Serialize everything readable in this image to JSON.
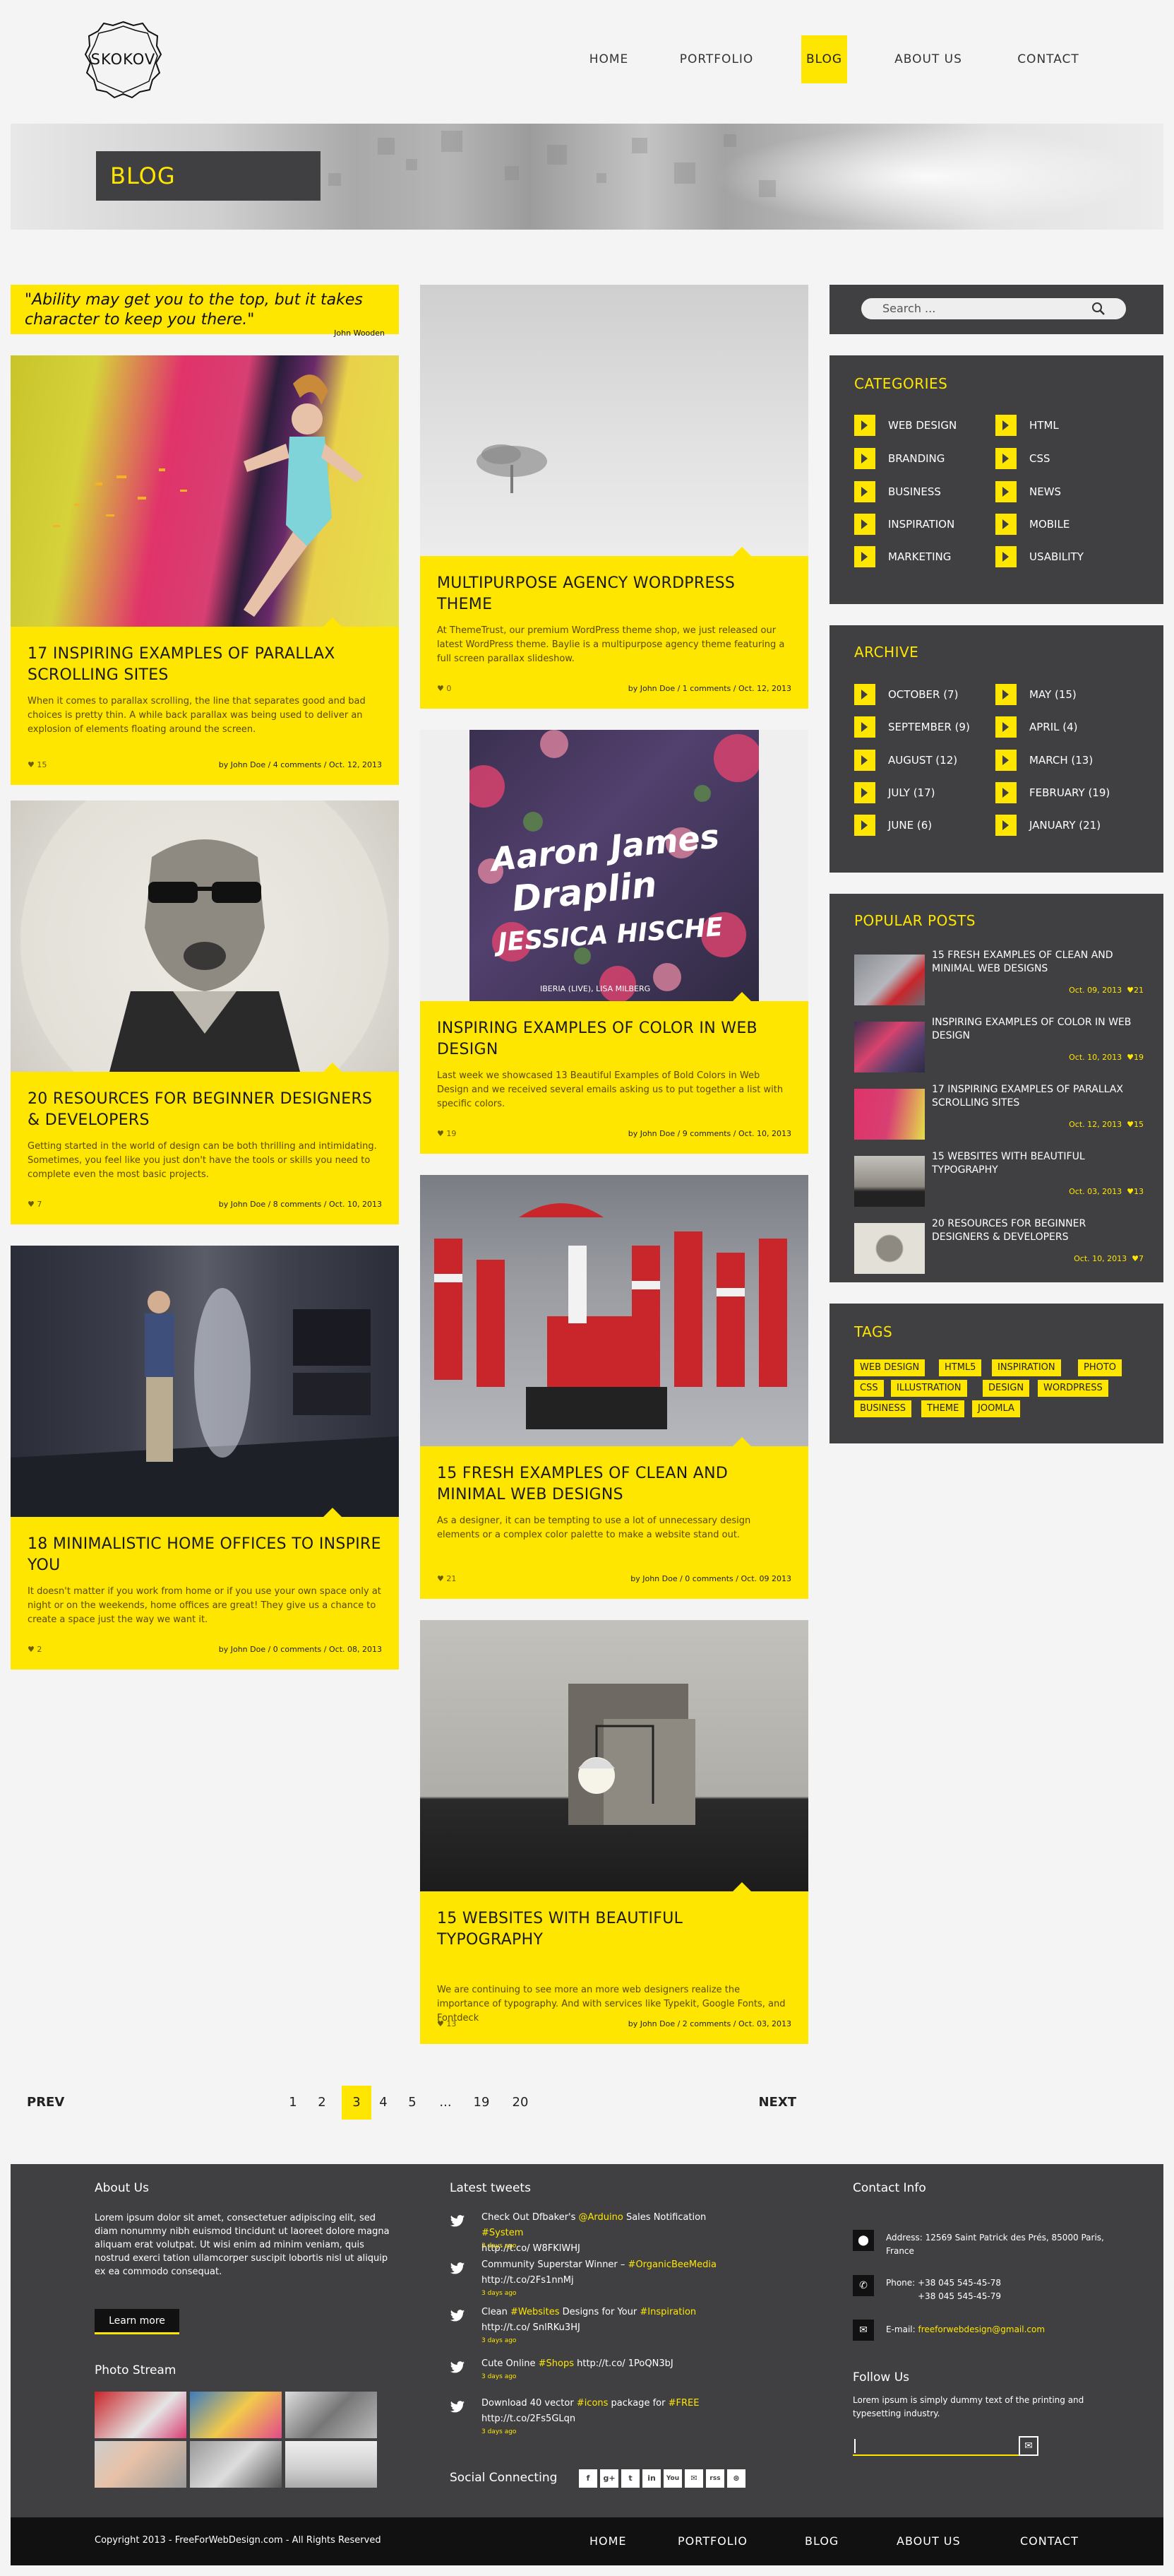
{
  "header": {
    "logo": "SKOKOV",
    "nav": [
      "HOME",
      "PORTFOLIO",
      "BLOG",
      "ABOUT US",
      "CONTACT"
    ],
    "active": "BLOG"
  },
  "banner": {
    "title": "BLOG"
  },
  "quote": {
    "text": "\"Ability may get you to the top, but it takes character to keep you there.\"",
    "author": "John Wooden"
  },
  "posts_left": [
    {
      "title": "17 INSPIRING EXAMPLES OF PARALLAX SCROLLING SITES",
      "excerpt": "When it comes to parallax scrolling, the line that separates good and bad choices is pretty thin. A while back parallax was being used to deliver an explosion of elements floating around the screen.",
      "likes": "15",
      "meta": "by John Doe  /  4 comments  /  Oct. 12, 2013"
    },
    {
      "title": "20 RESOURCES FOR BEGINNER DESIGNERS & DEVELOPERS",
      "excerpt": "Getting started in the world of design can be both thrilling and intimidating. Sometimes, you feel like you just don't have the tools or skills you need to complete even the most basic projects.",
      "likes": "7",
      "meta": "by John Doe  /  8 comments  /  Oct. 10, 2013"
    },
    {
      "title": "18 MINIMALISTIC HOME OFFICES TO INSPIRE YOU",
      "excerpt": "It doesn't matter if you work from home or if you use your own space only at night or on the weekends, home offices are great! They give us a chance to create a space just the way we want it.",
      "likes": "2",
      "meta": "by John Doe  /  0 comments  /  Oct. 08, 2013"
    }
  ],
  "posts_mid": [
    {
      "title": "MULTIPURPOSE AGENCY WORDPRESS THEME",
      "excerpt": "At ThemeTrust, our premium WordPress theme shop, we just released our latest WordPress theme. Baylie is a multipurpose agency theme featuring a full screen parallax slideshow.",
      "likes": "0",
      "meta": "by John Doe  /  1 comments  /  Oct. 12, 2013"
    },
    {
      "title": "INSPIRING EXAMPLES OF COLOR IN WEB DESIGN",
      "excerpt": "Last week we showcased 13 Beautiful Examples of Bold Colors in Web Design and we received several emails asking us to put together a list with specific colors.",
      "likes": "19",
      "meta": "by John Doe  /  9 comments  /  Oct. 10, 2013"
    },
    {
      "title": "15 FRESH EXAMPLES OF CLEAN AND MINIMAL WEB DESIGNS",
      "excerpt": "As a designer, it can be tempting to use a lot of unnecessary design elements or a complex color palette to make a website stand out.",
      "likes": "21",
      "meta": "by John Doe  /  0 comments  /  Oct. 09 2013"
    },
    {
      "title": "15 WEBSITES WITH BEAUTIFUL TYPOGRAPHY",
      "excerpt": "We are continuing to see more an more web designers realize the importance of typography. And with services like Typekit, Google Fonts, and Fontdeck",
      "likes": "13",
      "meta": "by John Doe  /  2 comments  /  Oct. 03, 2013"
    }
  ],
  "poster": {
    "line1": "Aaron James",
    "line2": "Draplin",
    "line3": "JESSICA HISCHE",
    "sub": "IBERIA (LIVE), LISA MILBERG"
  },
  "search": {
    "placeholder": "Search ..."
  },
  "categories": {
    "title": "CATEGORIES",
    "left": [
      "WEB DESIGN",
      "BRANDING",
      "BUSINESS",
      "INSPIRATION",
      "MARKETING"
    ],
    "right": [
      "HTML",
      "CSS",
      "NEWS",
      "MOBILE",
      "USABILITY"
    ]
  },
  "archive": {
    "title": "ARCHIVE",
    "left": [
      "OCTOBER  (7)",
      "SEPTEMBER  (9)",
      "AUGUST  (12)",
      "JULY  (17)",
      "JUNE  (6)"
    ],
    "right": [
      "MAY  (15)",
      "APRIL  (4)",
      "MARCH  (13)",
      "FEBRUARY  (19)",
      "JANUARY  (21)"
    ]
  },
  "popular": {
    "title": "POPULAR POSTS",
    "items": [
      {
        "title": "15 FRESH EXAMPLES OF CLEAN AND MINIMAL WEB DESIGNS",
        "date": "Oct. 09, 2013",
        "likes": "21"
      },
      {
        "title": "INSPIRING EXAMPLES OF COLOR IN WEB DESIGN",
        "date": "Oct. 10, 2013",
        "likes": "19"
      },
      {
        "title": "17 INSPIRING EXAMPLES OF PARALLAX SCROLLING SITES",
        "date": "Oct. 12, 2013",
        "likes": "15"
      },
      {
        "title": "15 WEBSITES WITH BEAUTIFUL TYPOGRAPHY",
        "date": "Oct. 03, 2013",
        "likes": "13"
      },
      {
        "title": "20 RESOURCES FOR BEGINNER DESIGNERS & DEVELOPERS",
        "date": "Oct. 10, 2013",
        "likes": "7"
      }
    ]
  },
  "tags": {
    "title": "TAGS",
    "items": [
      "WEB DESIGN",
      "HTML5",
      "INSPIRATION",
      "PHOTO",
      "CSS",
      "ILLUSTRATION",
      "DESIGN",
      "WORDPRESS",
      "BUSINESS",
      "THEME",
      "JOOMLA"
    ]
  },
  "pagination": {
    "prev": "PREV",
    "next": "NEXT",
    "pages": [
      "1",
      "2",
      "3",
      "4",
      "5",
      "...",
      "19",
      "20"
    ],
    "current": "3"
  },
  "footer": {
    "about_title": "About Us",
    "about_text": "Lorem ipsum dolor sit amet, consectetuer adipiscing elit, sed diam nonummy nibh euismod tincidunt ut laoreet dolore magna aliquam erat volutpat. Ut wisi enim ad minim veniam, quis nostrud exerci tation ullamcorper suscipit lobortis nisl ut aliquip ex ea commodo consequat.",
    "learn_more": "Learn more",
    "photo_title": "Photo Stream",
    "tweets_title": "Latest tweets",
    "tweets": [
      {
        "pre": "Check Out Dfbaker's ",
        "h1": "@Arduino",
        "mid": " Sales Notification ",
        "h2": "#System",
        "line2": "http://t.co/ W8FKlWHJ",
        "ago": "3 days ago"
      },
      {
        "pre": "Community Superstar Winner – ",
        "h1": "#OrganicBeeMedia",
        "mid": "",
        "h2": "",
        "line2": "http://t.co/2Fs1nnMj",
        "ago": "3 days ago"
      },
      {
        "pre": "Clean ",
        "h1": "#Websites",
        "mid": " Designs for Your ",
        "h2": "#Inspiration",
        "line2": "http://t.co/ SnlRKu3HJ",
        "ago": "3 days ago"
      },
      {
        "pre": "Cute Online ",
        "h1": "#Shops",
        "mid": " http://t.co/ 1PoQN3bJ",
        "h2": "",
        "line2": "",
        "ago": "3 days ago"
      },
      {
        "pre": "Download 40 vector ",
        "h1": "#icons",
        "mid": " package for ",
        "h2": "#FREE",
        "line2": "http://t.co/2Fs5GLqn",
        "ago": "3 days ago"
      }
    ],
    "social_title": "Social Connecting",
    "social": [
      "f",
      "g+",
      "t",
      "in",
      "You",
      "✉",
      "rss",
      "⊛"
    ],
    "contact_title": "Contact Info",
    "address": "Address: 12569 Saint Patrick des Prés, 85000 Paris, France",
    "phone_label": "Phone: ",
    "phone1": "+38 045 545-45-78",
    "phone2": "+38 045 545-45-79",
    "email_label": "E-mail: ",
    "email": "freeforwebdesign@gmail.com",
    "follow_title": "Follow Us",
    "follow_text": "Lorem ipsum is simply dummy text of the printing and typesetting industry.",
    "copyright": "Copyright 2013 - FreeForWebDesign.com - All Rights Reserved"
  },
  "colors": {
    "accent": "#ffe600",
    "dark": "#404043",
    "footer_bar": "#111111",
    "bg": "#f4f4f4"
  }
}
